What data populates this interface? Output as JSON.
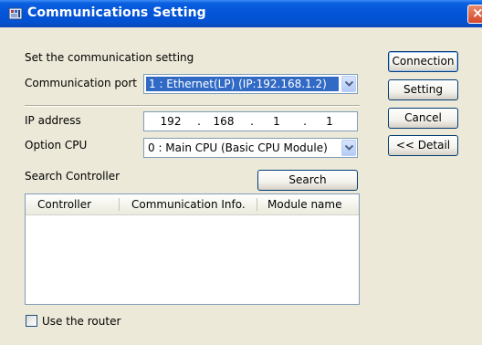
{
  "window": {
    "title": "Communications Setting"
  },
  "form": {
    "heading": "Set the communication setting",
    "comm_port": {
      "label": "Communication port",
      "value": "1 : Ethernet(LP) (IP:192.168.1.2)"
    },
    "ip": {
      "label": "IP address",
      "parts": [
        "192",
        "168",
        "1",
        "1"
      ],
      "sep": "."
    },
    "option_cpu": {
      "label": "Option CPU",
      "value": "0 : Main CPU (Basic CPU Module)"
    },
    "search_label": "Search Controller",
    "search_button": "Search"
  },
  "table": {
    "columns": [
      "Controller",
      "Communication Info.",
      "Module name"
    ],
    "rows": []
  },
  "router": {
    "label": "Use the router",
    "checked": false
  },
  "buttons": {
    "connection": "Connection",
    "setting": "Setting",
    "cancel": "Cancel",
    "detail": "<< Detail"
  },
  "icons": {
    "title": "app-icon",
    "close": "close-icon",
    "dropdown": "chevron-down-icon"
  }
}
